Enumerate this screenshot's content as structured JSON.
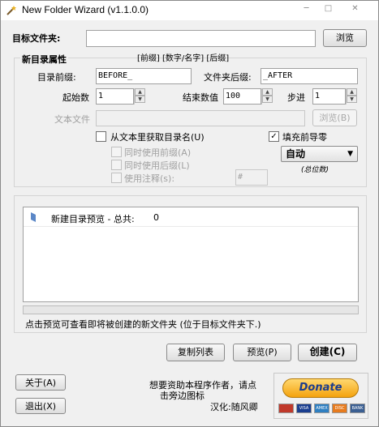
{
  "window": {
    "title": "New Folder Wizard   (v1.1.0.0)",
    "controls": [
      "minimize",
      "maximize",
      "close"
    ]
  },
  "target": {
    "label": "目标文件夹:",
    "value": "",
    "browse": "浏览"
  },
  "new_dir": {
    "group_label": "新目录属性",
    "format_hint": "[前缀] [数字/名字] [后缀]",
    "prefix_label": "目录前缀:",
    "prefix_value": "BEFORE_",
    "suffix_label": "文件夹后缀:",
    "suffix_value": "_AFTER",
    "start_label": "起始数",
    "start_value": "1",
    "end_label": "结束数值",
    "end_value": "100",
    "step_label": "步进",
    "step_value": "1",
    "textfile_label": "文本文件",
    "textfile_value": "",
    "textfile_browse": "浏览(B)",
    "from_text_label": "从文本里获取目录名(U)",
    "from_text_checked": false,
    "use_prefix_label": "同时使用前缀(A)",
    "use_suffix_label": "同时使用后缀(L)",
    "use_comment_label": "使用注释(s):",
    "comment_value": "#",
    "fill_zero_label": "填充前导零",
    "fill_zero_checked": true,
    "fill_select": "自动",
    "digits_label": "(总位数)"
  },
  "preview": {
    "title": "新建目录预览 - 总共:",
    "total": "0",
    "hint": "点击预览可查看即将被创建的新文件夹 (位于目标文件夹下.)"
  },
  "actions": {
    "copy_list": "复制列表",
    "preview": "预览(P)",
    "create": "创建(C)"
  },
  "footer": {
    "about": "关于(A)",
    "exit": "退出(X)",
    "donate_text_1": "想要资助本程序作者，请点",
    "donate_text_2": "击旁边图标",
    "translator": "汉化:随风卿",
    "donate_button": "Donate",
    "cards": [
      "VISA",
      "AMEX",
      "DISC",
      "BANK"
    ]
  },
  "colors": {
    "accent_orange": "#f4a20e",
    "donate_text": "#1c3d8c",
    "window_bg": "#f0f0f0"
  }
}
